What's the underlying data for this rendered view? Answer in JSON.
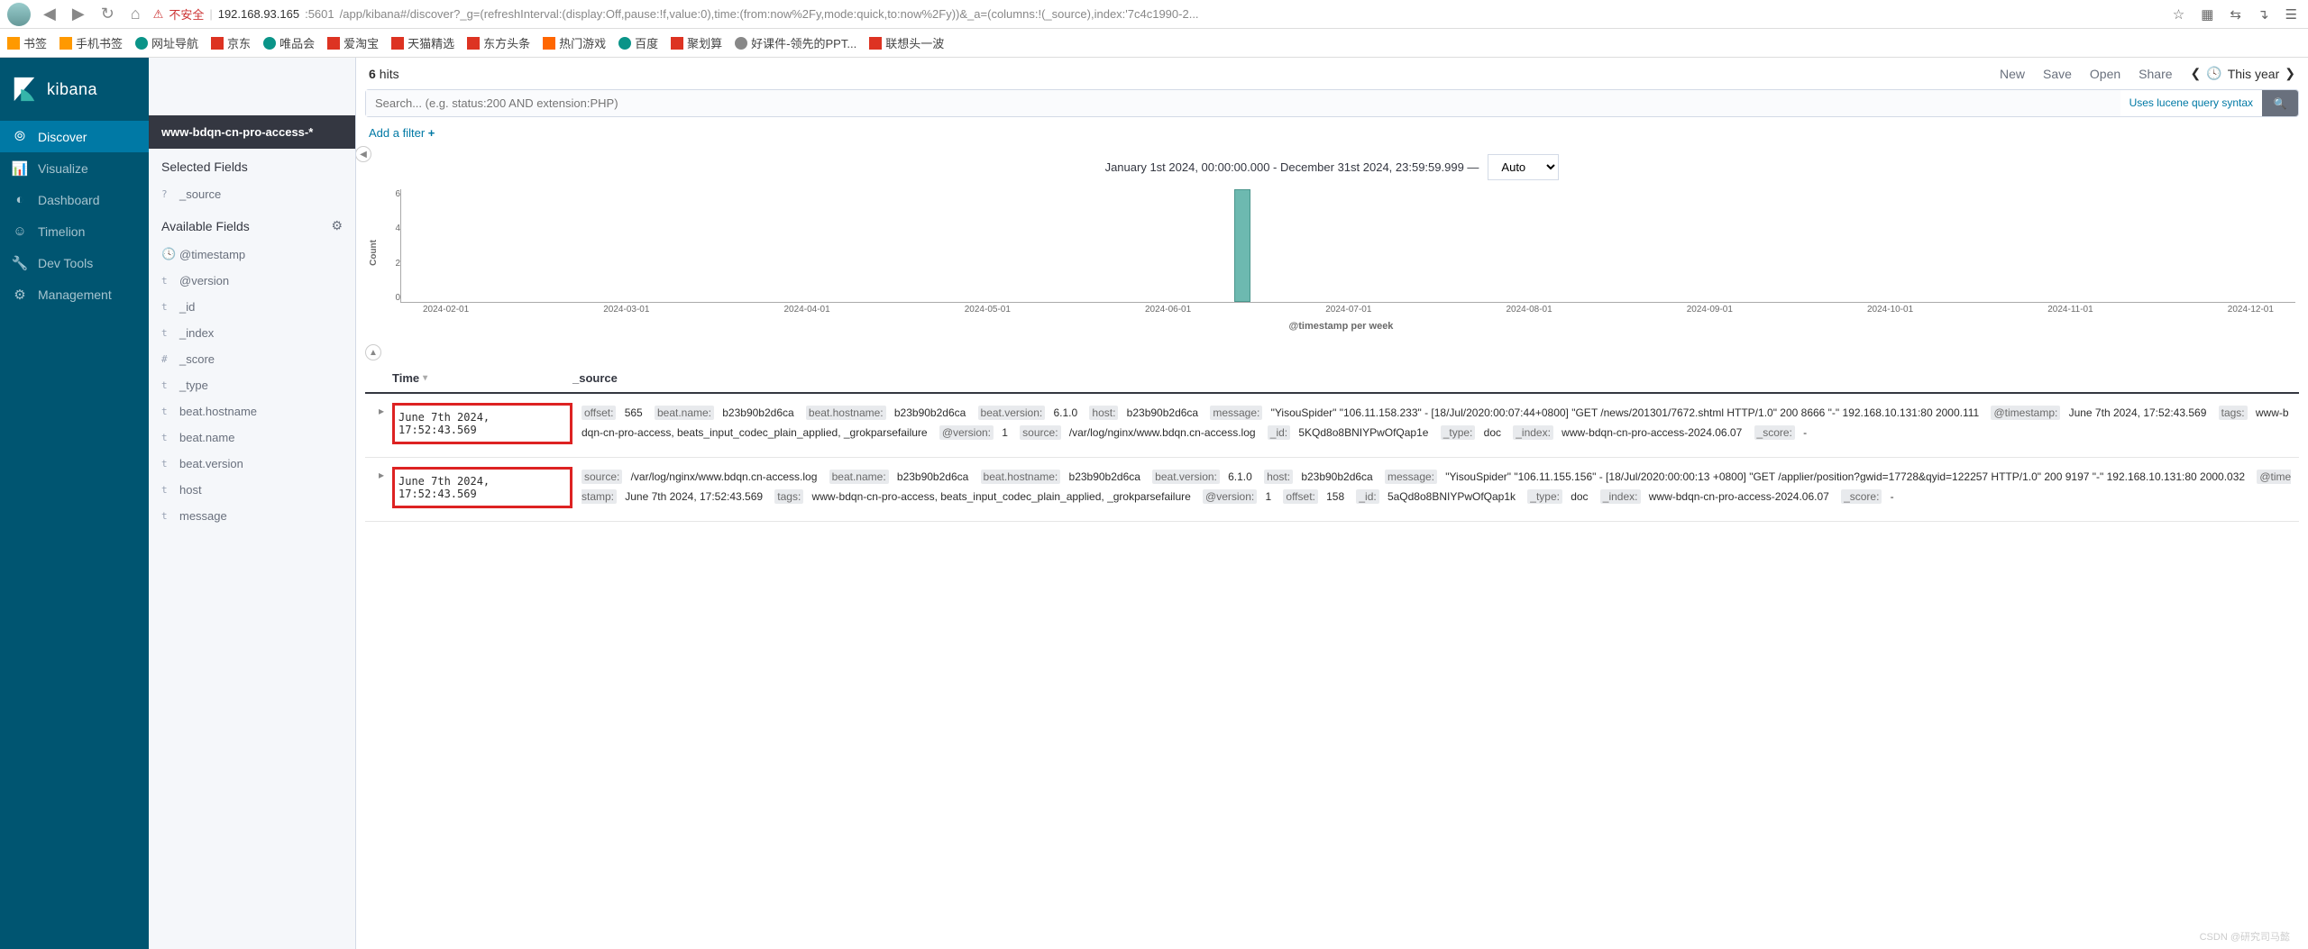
{
  "browser": {
    "insecure_label": "不安全",
    "url_host": "192.168.93.165",
    "url_port": ":5601",
    "url_path": "/app/kibana#/discover?_g=(refreshInterval:(display:Off,pause:!f,value:0),time:(from:now%2Fy,mode:quick,to:now%2Fy))&_a=(columns:!(_source),index:'7c4c1990-2...",
    "bookmarks": [
      "书签",
      "手机书签",
      "网址导航",
      "京东",
      "唯品会",
      "爱淘宝",
      "天猫精选",
      "东方头条",
      "热门游戏",
      "百度",
      "聚划算",
      "好课件-领先的PPT...",
      "联想头一波"
    ]
  },
  "nav": {
    "brand": "kibana",
    "items": [
      "Discover",
      "Visualize",
      "Dashboard",
      "Timelion",
      "Dev Tools",
      "Management"
    ]
  },
  "panel": {
    "index_pattern": "www-bdqn-cn-pro-access-*",
    "selected_label": "Selected Fields",
    "available_label": "Available Fields",
    "selected_fields": [
      {
        "type": "?",
        "name": "_source"
      }
    ],
    "available_fields": [
      {
        "type": "clock",
        "name": "@timestamp"
      },
      {
        "type": "t",
        "name": "@version"
      },
      {
        "type": "t",
        "name": "_id"
      },
      {
        "type": "t",
        "name": "_index"
      },
      {
        "type": "#",
        "name": "_score"
      },
      {
        "type": "t",
        "name": "_type"
      },
      {
        "type": "t",
        "name": "beat.hostname"
      },
      {
        "type": "t",
        "name": "beat.name"
      },
      {
        "type": "t",
        "name": "beat.version"
      },
      {
        "type": "t",
        "name": "host"
      },
      {
        "type": "t",
        "name": "message"
      }
    ]
  },
  "topbar": {
    "hits_num": "6",
    "hits_label": "hits",
    "links": [
      "New",
      "Save",
      "Open",
      "Share"
    ],
    "range": "This year"
  },
  "search": {
    "placeholder": "Search... (e.g. status:200 AND extension:PHP)",
    "hint": "Uses lucene query syntax"
  },
  "filter": {
    "add_label": "Add a filter"
  },
  "histogram": {
    "range_text": "January 1st 2024, 00:00:00.000 - December 31st 2024, 23:59:59.999 —",
    "interval": "Auto",
    "x_label": "@timestamp per week",
    "y_label": "Count"
  },
  "chart_data": {
    "type": "bar",
    "categories": [
      "2024-02-01",
      "2024-03-01",
      "2024-04-01",
      "2024-05-01",
      "2024-06-01",
      "2024-07-01",
      "2024-08-01",
      "2024-09-01",
      "2024-10-01",
      "2024-11-01",
      "2024-12-01"
    ],
    "bars": [
      {
        "x_frac": 0.44,
        "value": 6
      }
    ],
    "title": "",
    "xlabel": "@timestamp per week",
    "ylabel": "Count",
    "ylim": [
      0,
      6
    ],
    "y_ticks": [
      "0",
      "2",
      "4",
      "6"
    ]
  },
  "table": {
    "cols": {
      "time": "Time",
      "source": "_source"
    },
    "rows": [
      {
        "time": "June 7th 2024, 17:52:43.569",
        "source_kv": [
          {
            "k": "offset:",
            "v": "565"
          },
          {
            "k": "beat.name:",
            "v": "b23b90b2d6ca"
          },
          {
            "k": "beat.hostname:",
            "v": "b23b90b2d6ca"
          },
          {
            "k": "beat.version:",
            "v": "6.1.0"
          },
          {
            "k": "host:",
            "v": "b23b90b2d6ca"
          },
          {
            "k": "message:",
            "v": "\"YisouSpider\" \"106.11.158.233\" - [18/Jul/2020:00:07:44+0800] \"GET /news/201301/7672.shtml HTTP/1.0\" 200 8666 \"-\" 192.168.10.131:80 2000.111"
          },
          {
            "k": "@timestamp:",
            "v": "June 7th 2024, 17:52:43.569"
          },
          {
            "k": "tags:",
            "v": "www-bdqn-cn-pro-access, beats_input_codec_plain_applied, _grokparsefailure"
          },
          {
            "k": "@version:",
            "v": "1"
          },
          {
            "k": "source:",
            "v": "/var/log/nginx/www.bdqn.cn-access.log"
          },
          {
            "k": "_id:",
            "v": "5KQd8o8BNIYPwOfQap1e"
          },
          {
            "k": "_type:",
            "v": "doc"
          },
          {
            "k": "_index:",
            "v": "www-bdqn-cn-pro-access-2024.06.07"
          },
          {
            "k": "_score:",
            "v": "-"
          }
        ]
      },
      {
        "time": "June 7th 2024, 17:52:43.569",
        "source_kv": [
          {
            "k": "source:",
            "v": "/var/log/nginx/www.bdqn.cn-access.log"
          },
          {
            "k": "beat.name:",
            "v": "b23b90b2d6ca"
          },
          {
            "k": "beat.hostname:",
            "v": "b23b90b2d6ca"
          },
          {
            "k": "beat.version:",
            "v": "6.1.0"
          },
          {
            "k": "host:",
            "v": "b23b90b2d6ca"
          },
          {
            "k": "message:",
            "v": "\"YisouSpider\" \"106.11.155.156\" - [18/Jul/2020:00:00:13 +0800] \"GET /applier/position?gwid=17728&qyid=122257 HTTP/1.0\" 200 9197 \"-\" 192.168.10.131:80 2000.032"
          },
          {
            "k": "@timestamp:",
            "v": "June 7th 2024, 17:52:43.569"
          },
          {
            "k": "tags:",
            "v": "www-bdqn-cn-pro-access, beats_input_codec_plain_applied, _grokparsefailure"
          },
          {
            "k": "@version:",
            "v": "1"
          },
          {
            "k": "offset:",
            "v": "158"
          },
          {
            "k": "_id:",
            "v": "5aQd8o8BNIYPwOfQap1k"
          },
          {
            "k": "_type:",
            "v": "doc"
          },
          {
            "k": "_index:",
            "v": "www-bdqn-cn-pro-access-2024.06.07"
          },
          {
            "k": "_score:",
            "v": "-"
          }
        ]
      }
    ]
  },
  "watermark": "CSDN @研究司马懿"
}
